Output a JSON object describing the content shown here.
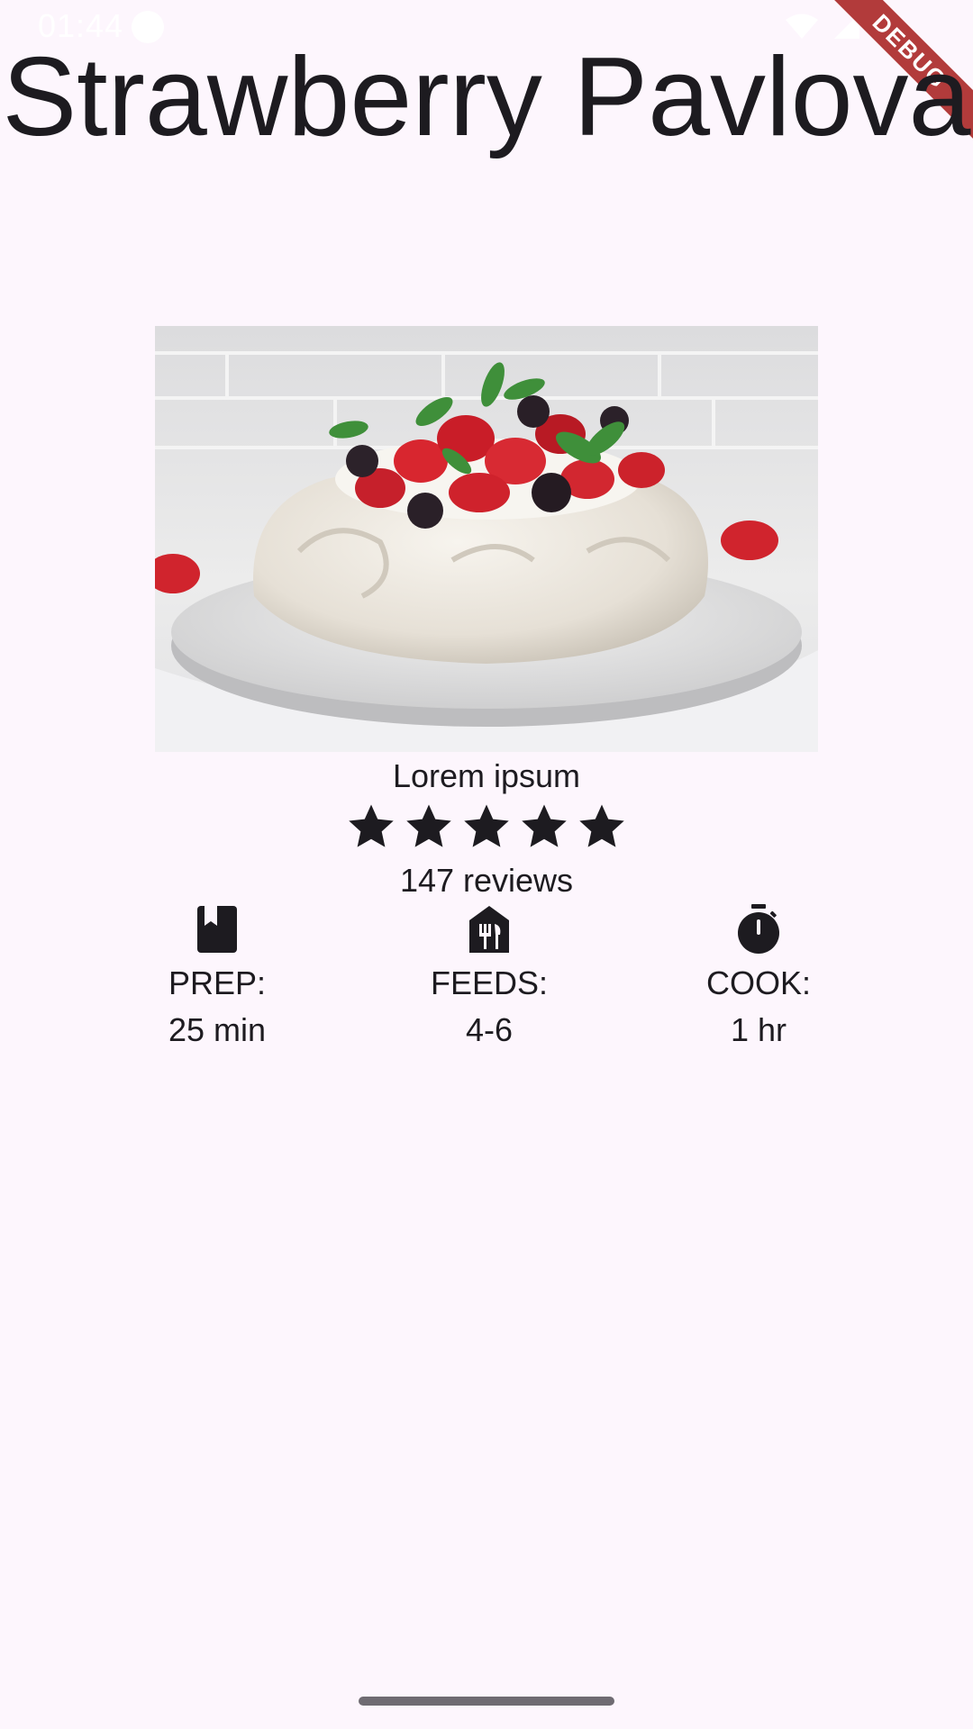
{
  "status_bar": {
    "time": "01:44"
  },
  "debug_banner": {
    "label": "DEBUG"
  },
  "recipe": {
    "title": "Strawberry Pavlova",
    "image_subject": "strawberry pavlova with berries and mint",
    "subtitle": "Lorem ipsum",
    "rating": {
      "stars": 5,
      "max_stars": 5
    },
    "reviews": "147 reviews",
    "info": [
      {
        "icon": "book-icon",
        "label": "PREP:",
        "value": "25 min"
      },
      {
        "icon": "restaurant-icon",
        "label": "FEEDS:",
        "value": "4-6"
      },
      {
        "icon": "timer-icon",
        "label": "COOK:",
        "value": "1 hr"
      }
    ]
  },
  "colors": {
    "background": "#fdf6fd",
    "text": "#1d1b20",
    "debug_ribbon": "#b23b3b"
  }
}
